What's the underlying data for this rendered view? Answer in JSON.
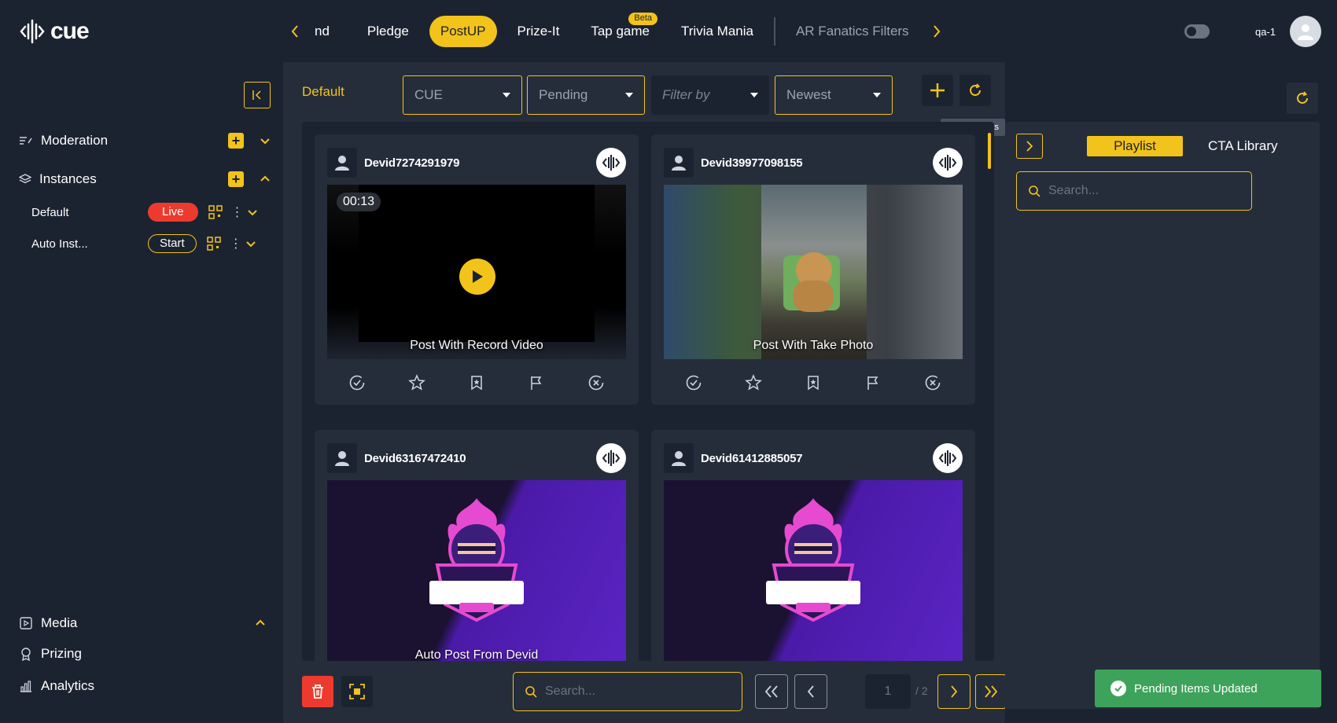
{
  "app": {
    "logo_text": "cue"
  },
  "top_tabs": {
    "items": [
      {
        "label": "nd"
      },
      {
        "label": "Pledge"
      },
      {
        "label": "PostUP"
      },
      {
        "label": "Prize-It"
      },
      {
        "label": "Tap game",
        "badge": "Beta"
      },
      {
        "label": "Trivia Mania"
      },
      {
        "label": "AR Fanatics Filters"
      }
    ],
    "active": "PostUP"
  },
  "user": {
    "name": "qa-1"
  },
  "sidebar": {
    "moderation_label": "Moderation",
    "instances_label": "Instances",
    "instances": [
      {
        "label": "Default",
        "status": "Live"
      },
      {
        "label": "Auto Inst...",
        "status": "Start"
      }
    ],
    "bottom_items": [
      {
        "label": "Media"
      },
      {
        "label": "Prizing"
      },
      {
        "label": "Analytics"
      }
    ]
  },
  "main": {
    "instance_label": "Default",
    "filters": {
      "source": "CUE",
      "status": "Pending",
      "filter_by_placeholder": "Filter by",
      "sort": "Newest"
    },
    "tooltip": "Update Posts",
    "posts": [
      {
        "user": "Devid7274291979",
        "caption": "Post With Record Video",
        "duration": "00:13",
        "type": "video"
      },
      {
        "user": "Devid39977098155",
        "caption": "Post With Take Photo",
        "type": "photo"
      },
      {
        "user": "Devid63167472410",
        "caption": "Auto Post From Devid",
        "type": "image"
      },
      {
        "user": "Devid61412885057",
        "caption": "",
        "type": "image"
      }
    ],
    "search_placeholder": "Search...",
    "pagination": {
      "current": "1",
      "total": "/ 2"
    }
  },
  "right_panel": {
    "tabs": [
      {
        "label": "Playlist"
      },
      {
        "label": "CTA Library"
      }
    ],
    "search_placeholder": "Search..."
  },
  "toast": {
    "message": "Pending Items Updated"
  },
  "colors": {
    "accent": "#f2c31a",
    "danger": "#ec3b2e",
    "success": "#3ea35a",
    "bg": "#1c2330",
    "panel": "#252d3a"
  }
}
